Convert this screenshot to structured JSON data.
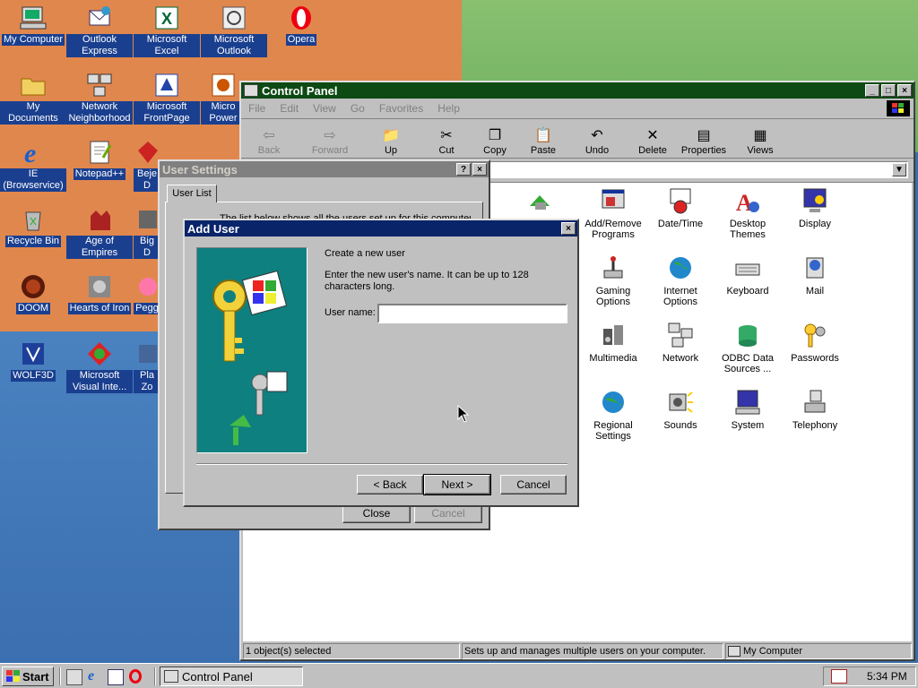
{
  "desktop": {
    "icons": [
      {
        "label": "My Computer",
        "icon": "computer-icon"
      },
      {
        "label": "Outlook Express",
        "icon": "outlook-express-icon"
      },
      {
        "label": "Microsoft Excel",
        "icon": "excel-icon"
      },
      {
        "label": "Microsoft Outlook",
        "icon": "outlook-icon"
      },
      {
        "label": "Opera",
        "icon": "opera-icon"
      },
      {
        "label": "My Documents",
        "icon": "folder-icon"
      },
      {
        "label": "Network Neighborhood",
        "icon": "network-icon"
      },
      {
        "label": "Microsoft FrontPage",
        "icon": "frontpage-icon"
      },
      {
        "label": "Micro Power",
        "icon": "powerpoint-icon"
      },
      {
        "label": "IE (Browservice)",
        "icon": "ie-icon"
      },
      {
        "label": "Notepad++",
        "icon": "notepad-icon"
      },
      {
        "label": "Beje D",
        "icon": "bejeweled-icon"
      },
      {
        "label": "Recycle Bin",
        "icon": "recycle-bin-icon"
      },
      {
        "label": "Age of Empires",
        "icon": "age-of-empires-icon"
      },
      {
        "label": "Big D",
        "icon": "game-icon"
      },
      {
        "label": "DOOM",
        "icon": "doom-icon"
      },
      {
        "label": "Hearts of Iron",
        "icon": "hearts-of-iron-icon"
      },
      {
        "label": "Pegg",
        "icon": "peggle-icon"
      },
      {
        "label": "WOLF3D",
        "icon": "wolf3d-icon"
      },
      {
        "label": "Microsoft Visual Inte...",
        "icon": "visual-interdev-icon"
      },
      {
        "label": "Pla Zo",
        "icon": "game-icon"
      }
    ]
  },
  "control_panel": {
    "title": "Control Panel",
    "menu": [
      "File",
      "Edit",
      "View",
      "Go",
      "Favorites",
      "Help"
    ],
    "toolbar": [
      "Back",
      "Forward",
      "Up",
      "Cut",
      "Copy",
      "Paste",
      "Undo",
      "Delete",
      "Properties",
      "Views"
    ],
    "items": [
      {
        "label": "Add/Remove Programs",
        "icon": "add-remove-icon"
      },
      {
        "label": "Date/Time",
        "icon": "clock-icon"
      },
      {
        "label": "Desktop Themes",
        "icon": "themes-icon"
      },
      {
        "label": "Display",
        "icon": "display-icon"
      },
      {
        "label": "Gaming Options",
        "icon": "joystick-icon"
      },
      {
        "label": "Internet Options",
        "icon": "globe-icon"
      },
      {
        "label": "Keyboard",
        "icon": "keyboard-icon"
      },
      {
        "label": "Mail",
        "icon": "mail-icon"
      },
      {
        "label": "Multimedia",
        "icon": "multimedia-icon"
      },
      {
        "label": "Network",
        "icon": "network-icon"
      },
      {
        "label": "ODBC Data Sources ...",
        "icon": "odbc-icon"
      },
      {
        "label": "Passwords",
        "icon": "keys-icon"
      },
      {
        "label": "Regional Settings",
        "icon": "globe-icon"
      },
      {
        "label": "Sounds",
        "icon": "speaker-icon"
      },
      {
        "label": "System",
        "icon": "system-icon"
      },
      {
        "label": "Telephony",
        "icon": "telephone-icon"
      }
    ],
    "status": {
      "selected": "1 object(s) selected",
      "description": "Sets up and manages multiple users on your computer.",
      "zone": "My Computer"
    }
  },
  "user_settings": {
    "title": "User Settings",
    "tab": "User List",
    "text": "The list below shows all the users set up for this computer.",
    "close": "Close",
    "cancel": "Cancel"
  },
  "add_user": {
    "title": "Add User",
    "heading": "Create a new user",
    "description": "Enter the new user's name. It can be up to 128 characters long.",
    "field_label": "User name:",
    "field_value": "",
    "back": "< Back",
    "next": "Next >",
    "cancel": "Cancel"
  },
  "taskbar": {
    "start": "Start",
    "task": "Control Panel",
    "clock": "5:34 PM"
  }
}
